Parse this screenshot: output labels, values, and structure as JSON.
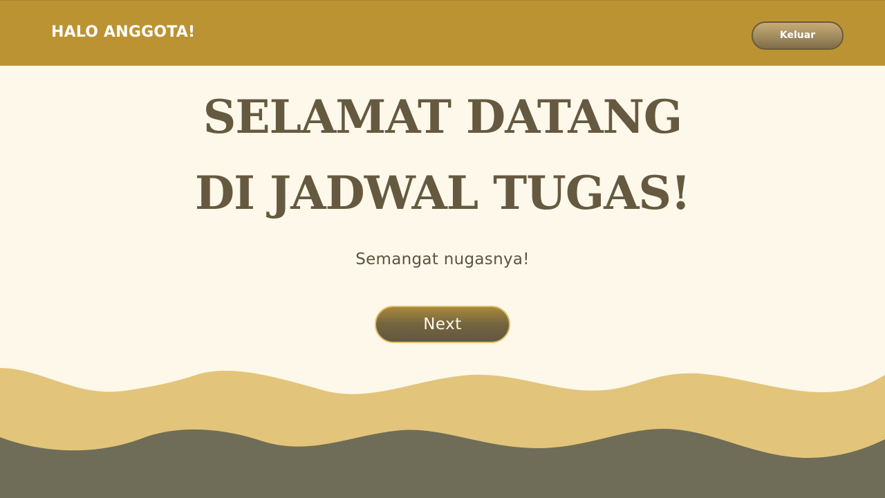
{
  "header": {
    "greeting": "HALO ANGGOTA!",
    "logout_label": "Keluar"
  },
  "main": {
    "headline_line1": "SELAMAT DATANG",
    "headline_line2": "DI JADWAL TUGAS!",
    "subtitle": "Semangat nugasnya!",
    "next_label": "Next"
  },
  "colors": {
    "header_bg": "#bb9333",
    "page_bg": "#fdf8ea",
    "headline": "#655940",
    "wave_light": "#e2c57a",
    "wave_dark": "#6f6d57"
  }
}
